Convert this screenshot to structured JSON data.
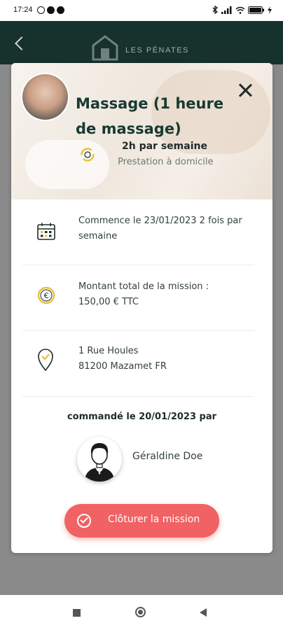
{
  "status_bar": {
    "time": "17:24",
    "icons": [
      "alarm-icon",
      "notification-icon",
      "notification-icon",
      "bluetooth-icon",
      "signal-icon",
      "wifi-icon",
      "battery-icon",
      "charging-icon"
    ]
  },
  "header": {
    "brand": "LES PÉNATES",
    "back_icon": "chevron-left-icon",
    "logo_icon": "house-logo-icon"
  },
  "mission": {
    "title": "Massage (1 heure de massage)",
    "frequency": "2h par semaine",
    "place": "Prestation à domicile",
    "rows": [
      {
        "icon": "calendar-icon",
        "text": "Commence le 23/01/2023 2 fois par semaine"
      },
      {
        "icon": "euro-coin-icon",
        "text": "Montant total de la mission : 150,00 € TTC"
      },
      {
        "icon": "location-pin-icon",
        "line1": "1 Rue Houles",
        "line2": "81200 Mazamet FR"
      }
    ],
    "ordered_by_label": "commandé le 20/01/2023 par",
    "client_name": "Géraldine Doe",
    "close_button_label": "Clôturer la mission"
  },
  "colors": {
    "header_bg": "#17312c",
    "title": "#173a32",
    "button": "#f06263",
    "accent_yellow": "#e7c23a"
  }
}
